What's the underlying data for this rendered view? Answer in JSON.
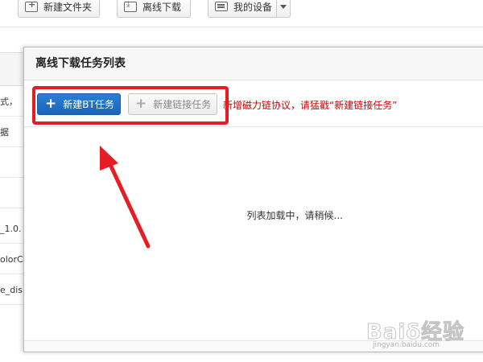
{
  "toolbar": {
    "new_folder": "新建文件夹",
    "offline_download": "离线下载",
    "my_devices": "我的设备"
  },
  "file_list": {
    "rows": [
      "式，",
      "据",
      "_1.0.",
      "olorC",
      "e_dis"
    ]
  },
  "dialog": {
    "title": "离线下载任务列表",
    "new_bt_task": "新建BT任务",
    "new_link_task": "新建链接任务",
    "hint": "新增磁力链协议，请猛戳“新建链接任务”",
    "loading": "列表加载中，请稍候..."
  },
  "annotation": {
    "color": "#e51e25"
  },
  "watermark": {
    "text": "Baiδ经验",
    "url": "jingyan.baidu.com"
  }
}
